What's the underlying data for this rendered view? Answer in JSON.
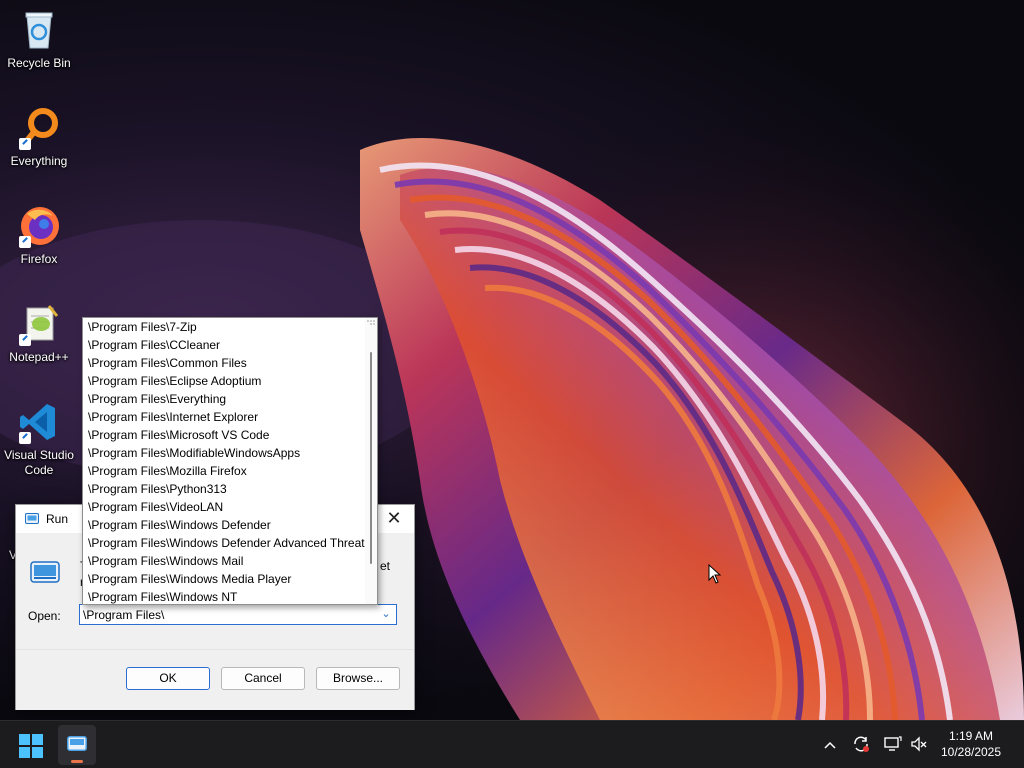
{
  "desktop": {
    "icons": [
      {
        "label": "Recycle Bin"
      },
      {
        "label": "Everything"
      },
      {
        "label": "Firefox"
      },
      {
        "label": "Notepad++"
      },
      {
        "label": "Visual Studio Code"
      }
    ],
    "partial_icon_letter": "V"
  },
  "run_dialog": {
    "title": "Run",
    "close_glyph": "✕",
    "desc_fragment_1": "T",
    "desc_fragment_2": "r",
    "desc_fragment_3": "et",
    "open_label": "Open:",
    "open_value": "\\Program Files\\",
    "dropdown_glyph": "⌄",
    "buttons": {
      "ok": "OK",
      "cancel": "Cancel",
      "browse": "Browse..."
    },
    "autocomplete": [
      "\\Program Files\\7-Zip",
      "\\Program Files\\CCleaner",
      "\\Program Files\\Common Files",
      "\\Program Files\\Eclipse Adoptium",
      "\\Program Files\\Everything",
      "\\Program Files\\Internet Explorer",
      "\\Program Files\\Microsoft VS Code",
      "\\Program Files\\ModifiableWindowsApps",
      "\\Program Files\\Mozilla Firefox",
      "\\Program Files\\Python313",
      "\\Program Files\\VideoLAN",
      "\\Program Files\\Windows Defender",
      "\\Program Files\\Windows Defender Advanced Threat",
      "\\Program Files\\Windows Mail",
      "\\Program Files\\Windows Media Player",
      "\\Program Files\\Windows NT"
    ]
  },
  "taskbar": {
    "tray_icons": [
      "chevron-up-icon",
      "sync-icon",
      "display-icon",
      "speaker-muted-icon"
    ],
    "clock": {
      "time": "1:19 AM",
      "date": "10/28/2025"
    },
    "accent": "#e9764a"
  }
}
